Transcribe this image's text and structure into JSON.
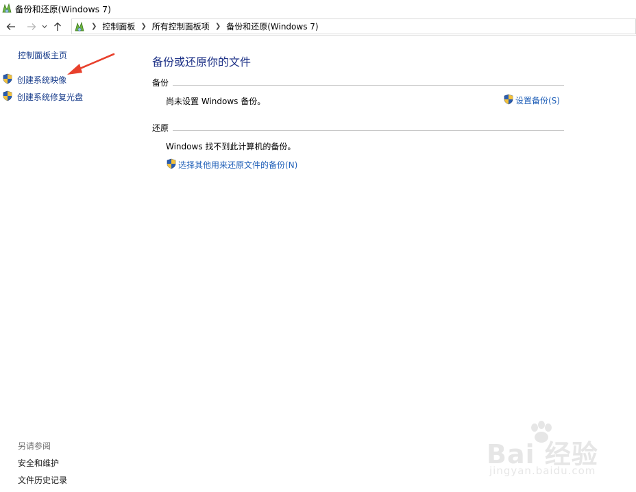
{
  "window": {
    "title": "备份和还原(Windows 7)"
  },
  "nav": {
    "back_icon": "back-arrow-icon",
    "forward_icon": "forward-arrow-icon",
    "recent_icon": "chevron-down-icon",
    "up_icon": "up-arrow-icon",
    "breadcrumbs": [
      "控制面板",
      "所有控制面板项",
      "备份和还原(Windows 7)"
    ]
  },
  "sidebar": {
    "home_link": "控制面板主页",
    "tasks": [
      {
        "label": "创建系统映像",
        "icon": "uac-shield-icon"
      },
      {
        "label": "创建系统修复光盘",
        "icon": "uac-shield-icon"
      }
    ],
    "see_also_title": "另请参阅",
    "see_also": [
      "安全和维护",
      "文件历史记录"
    ]
  },
  "main": {
    "title": "备份或还原你的文件",
    "backup": {
      "header": "备份",
      "status": "尚未设置 Windows 备份。",
      "setup_link": "设置备份(S)"
    },
    "restore": {
      "header": "还原",
      "status": "Windows 找不到此计算机的备份。",
      "select_link": "选择其他用来还原文件的备份(N)"
    }
  },
  "watermark": {
    "main": "Bai 经验",
    "sub": "jingyan.baidu.com"
  },
  "colors": {
    "link_blue": "#1a3e8c",
    "action_blue": "#1f5fb8",
    "title_blue": "#1e3287",
    "annotation_red": "#e8402c"
  }
}
